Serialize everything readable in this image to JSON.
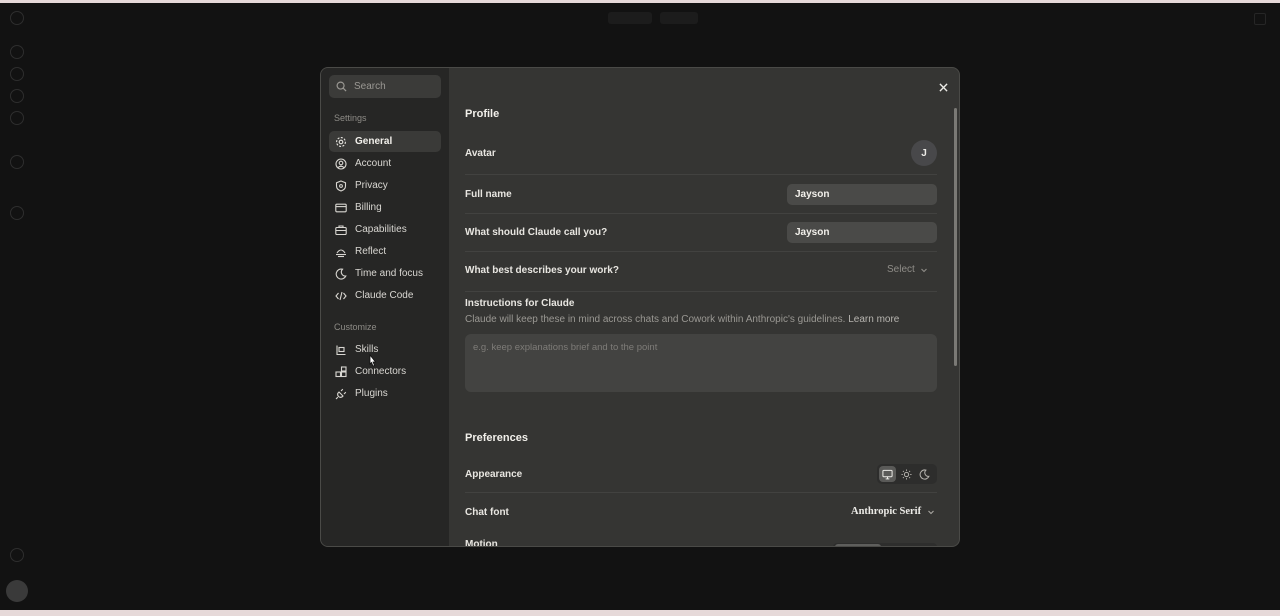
{
  "sidebar": {
    "search_placeholder": "Search",
    "settings_label": "Settings",
    "customize_label": "Customize",
    "settings_items": [
      {
        "label": "General",
        "icon": "gear-icon",
        "active": true
      },
      {
        "label": "Account",
        "icon": "user-circle-icon"
      },
      {
        "label": "Privacy",
        "icon": "shield-icon"
      },
      {
        "label": "Billing",
        "icon": "credit-card-icon"
      },
      {
        "label": "Capabilities",
        "icon": "briefcase-icon"
      },
      {
        "label": "Reflect",
        "icon": "reflect-icon"
      },
      {
        "label": "Time and focus",
        "icon": "moon-clock-icon"
      },
      {
        "label": "Claude Code",
        "icon": "code-icon"
      }
    ],
    "customize_items": [
      {
        "label": "Skills",
        "icon": "skills-icon"
      },
      {
        "label": "Connectors",
        "icon": "connectors-icon"
      },
      {
        "label": "Plugins",
        "icon": "plug-icon"
      }
    ]
  },
  "profile": {
    "section_title": "Profile",
    "avatar_label": "Avatar",
    "avatar_initial": "J",
    "full_name_label": "Full name",
    "full_name_value": "Jayson",
    "call_you_label": "What should Claude call you?",
    "call_you_value": "Jayson",
    "work_label": "What best describes your work?",
    "work_select": "Select",
    "instructions_label": "Instructions for Claude",
    "instructions_desc": "Claude will keep these in mind across chats and Cowork within Anthropic's guidelines.",
    "learn_more": "Learn more",
    "instructions_placeholder": "e.g. keep explanations brief and to the point"
  },
  "preferences": {
    "section_title": "Preferences",
    "appearance_label": "Appearance",
    "appearance_options": [
      "desktop-icon",
      "sun-icon",
      "moon-icon"
    ],
    "appearance_selected": "desktop-icon",
    "chat_font_label": "Chat font",
    "chat_font_value": "Anthropic Serif",
    "motion_label": "Motion"
  },
  "colors": {
    "modal_bg": "#353533",
    "sidebar_bg": "#262625",
    "page_bg": "#121212"
  }
}
